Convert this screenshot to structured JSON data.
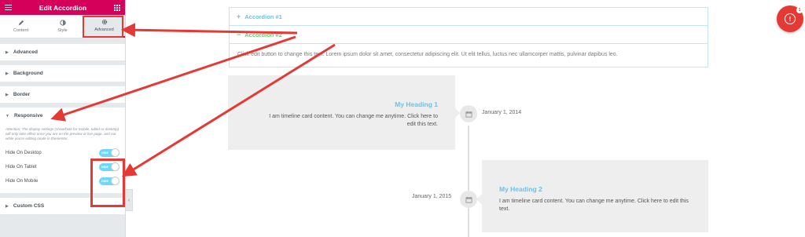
{
  "panel": {
    "title": "Edit Accordion",
    "tabs": [
      {
        "label": "Content",
        "icon": "pencil-icon"
      },
      {
        "label": "Style",
        "icon": "contrast-icon"
      },
      {
        "label": "Advanced",
        "icon": "gear-icon",
        "active": true
      }
    ],
    "sections": [
      "Advanced",
      "Background",
      "Border"
    ],
    "responsive": {
      "title": "Responsive",
      "note": "Attention: The display settings (show/hide for mobile, tablet or desktop) will only take effect once you are on the preview or live page, and not while you're editing mode in Elementor.",
      "toggles": [
        {
          "label": "Hide On Desktop",
          "state": "HIDE"
        },
        {
          "label": "Hide On Tablet",
          "state": "HIDE"
        },
        {
          "label": "Hide On Mobile",
          "state": "HIDE"
        }
      ]
    },
    "custom_css": "Custom CSS"
  },
  "accordion": {
    "items": [
      {
        "label": "Accordion #1",
        "symbol": "+"
      },
      {
        "label": "Accordion #2",
        "symbol": "−"
      }
    ],
    "content": "Click edit button to change this text. Lorem ipsum dolor sit amet, consectetur adipiscing elit. Ut elit tellus, luctus nec ullamcorper mattis, pulvinar dapibus leo."
  },
  "timeline": [
    {
      "heading": "My Heading 1",
      "text": "I am timeline card content. You can change me anytime. Click here to edit this text.",
      "date": "January 1, 2014"
    },
    {
      "heading": "My Heading 2",
      "text": "I am timeline card content. You can change me anytime. Click here to edit this text.",
      "date": "January 1, 2015"
    }
  ],
  "notification": {
    "badge": "1",
    "icon": "alert-icon"
  },
  "colors": {
    "brand": "#d5005a",
    "accent": "#6ec1e4",
    "active": "#61ce70",
    "annotation": "#e53935"
  }
}
